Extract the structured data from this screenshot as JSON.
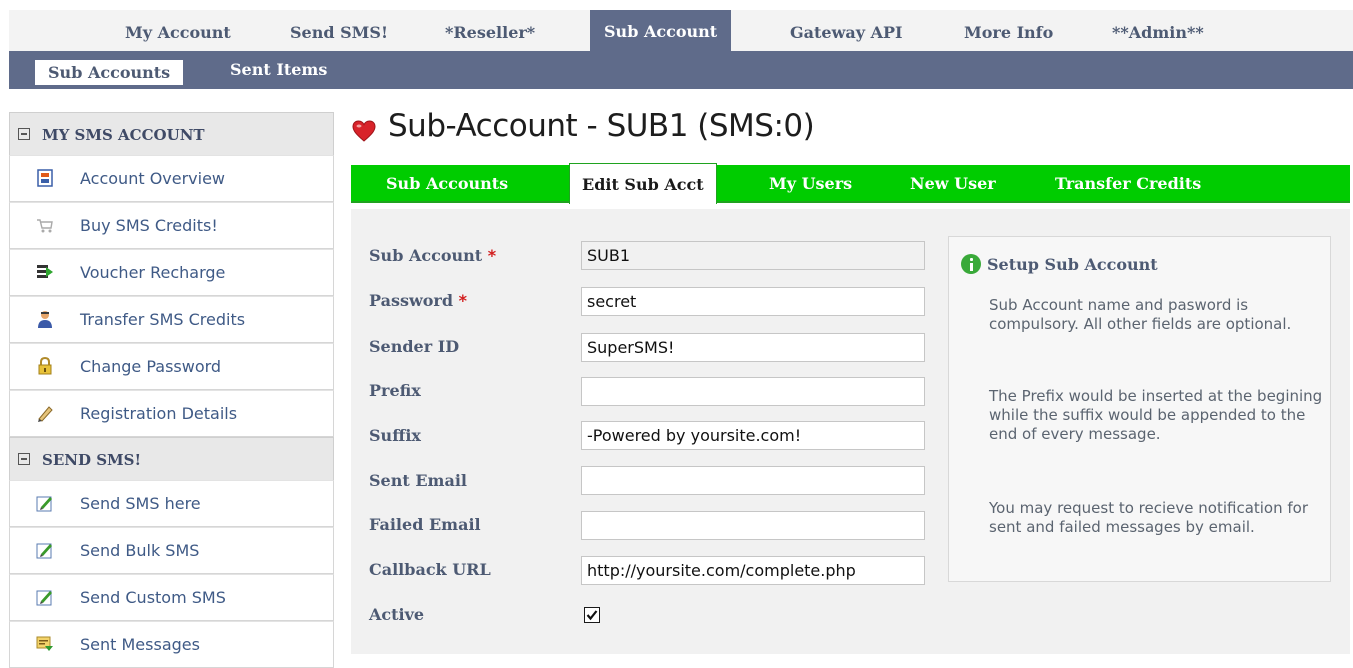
{
  "top_nav": {
    "items": [
      "My Account",
      "Send SMS!",
      "*Reseller*",
      "Sub Account",
      "Gateway API",
      "More Info",
      "**Admin**"
    ],
    "active": "Sub Account"
  },
  "sub_nav": {
    "items": [
      "Sub Accounts",
      "Sent Items"
    ],
    "active": "Sub Accounts"
  },
  "sidebar": {
    "sections": [
      {
        "title": "MY SMS ACCOUNT",
        "items": [
          {
            "label": "Account Overview",
            "icon": "account-overview-icon"
          },
          {
            "label": "Buy SMS Credits!",
            "icon": "cart-icon"
          },
          {
            "label": "Voucher Recharge",
            "icon": "voucher-icon"
          },
          {
            "label": "Transfer SMS Credits",
            "icon": "user-icon"
          },
          {
            "label": "Change Password",
            "icon": "lock-icon"
          },
          {
            "label": "Registration Details",
            "icon": "pencil-icon"
          }
        ]
      },
      {
        "title": "SEND SMS!",
        "items": [
          {
            "label": "Send SMS here",
            "icon": "edit-icon"
          },
          {
            "label": "Send Bulk SMS",
            "icon": "edit-icon"
          },
          {
            "label": "Send Custom SMS",
            "icon": "edit-icon"
          },
          {
            "label": "Sent Messages",
            "icon": "messages-icon"
          }
        ]
      }
    ]
  },
  "page": {
    "title": "Sub-Account - SUB1 (SMS:0)"
  },
  "tabs": {
    "items": [
      "Sub Accounts",
      "Edit Sub Acct",
      "My Users",
      "New User",
      "Transfer Credits"
    ],
    "active": "Edit Sub Acct"
  },
  "form": {
    "sub_account": {
      "label": "Sub Account",
      "required_mark": "*",
      "value": "SUB1"
    },
    "password": {
      "label": "Password",
      "required_mark": "*",
      "value": "secret"
    },
    "sender_id": {
      "label": "Sender ID",
      "value": "SuperSMS!"
    },
    "prefix": {
      "label": "Prefix",
      "value": ""
    },
    "suffix": {
      "label": "Suffix",
      "value": "-Powered by yoursite.com!"
    },
    "sent_email": {
      "label": "Sent Email",
      "value": ""
    },
    "failed_email": {
      "label": "Failed Email",
      "value": ""
    },
    "callback_url": {
      "label": "Callback URL",
      "value": "http://yoursite.com/complete.php"
    },
    "active": {
      "label": "Active",
      "checked": true
    }
  },
  "help": {
    "title": "Setup Sub Account",
    "paragraphs": [
      "Sub Account name and pasword is compulsory. All other fields are optional.",
      "The Prefix would be inserted at the begining while the suffix would be appended to the end of every message.",
      "You may request to recieve notification for sent and failed messages by email."
    ]
  },
  "colors": {
    "nav_bar": "#5f6b8a",
    "tab_green": "#00cc00",
    "required": "#d21d1d"
  }
}
